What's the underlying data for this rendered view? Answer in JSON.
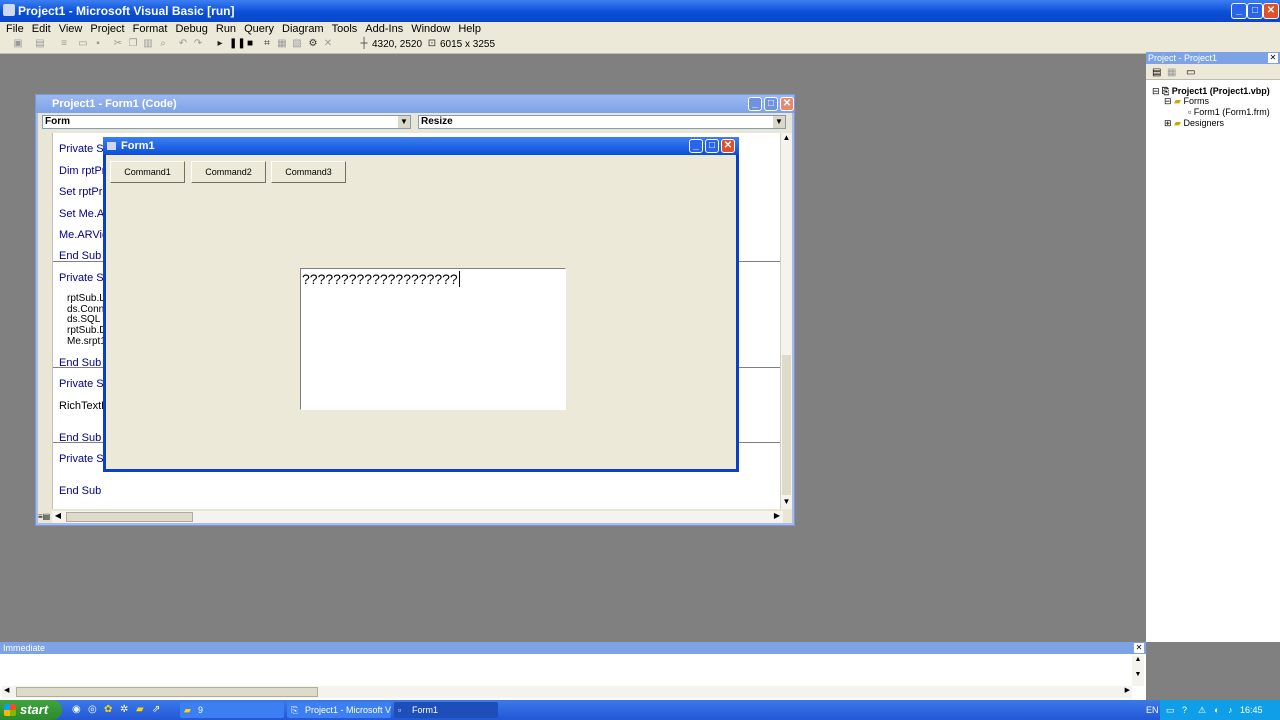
{
  "app": {
    "title": "Project1 - Microsoft Visual Basic [run]"
  },
  "menubar": [
    {
      "label": "File"
    },
    {
      "label": "Edit"
    },
    {
      "label": "View"
    },
    {
      "label": "Project"
    },
    {
      "label": "Format"
    },
    {
      "label": "Debug"
    },
    {
      "label": "Run"
    },
    {
      "label": "Query"
    },
    {
      "label": "Diagram"
    },
    {
      "label": "Tools"
    },
    {
      "label": "Add-Ins"
    },
    {
      "label": "Window"
    },
    {
      "label": "Help"
    }
  ],
  "toolbar": {
    "position": "4320, 2520",
    "size": "6015 x 3255"
  },
  "code_window": {
    "title": "Project1 - Form1 (Code)",
    "object_combo": "Form",
    "procedure_combo": "Resize",
    "lines": [
      "Private Sub",
      "Dim rptPrint",
      "Set rptPrint",
      "Set Me.AR",
      "Me.ARView",
      "End Sub",
      "Private Sub",
      "rptSub.Lo",
      "ds.Conne",
      "ds.SQL =",
      "rptSub.Da",
      "Me.srpt1.",
      "End Sub",
      "Private Sub",
      "RichTextBo",
      "End Sub",
      "Private Sub",
      "End Sub"
    ]
  },
  "form1": {
    "title": "Form1",
    "buttons": [
      "Command1",
      "Command2",
      "Command3"
    ],
    "rich_text": "????????????????????"
  },
  "project_explorer": {
    "title": "Project - Project1",
    "root": "Project1 (Project1.vbp)",
    "forms_folder": "Forms",
    "form_item": "Form1 (Form1.frm)",
    "designers_folder": "Designers"
  },
  "immediate": {
    "title": "Immediate"
  },
  "taskbar": {
    "start": "start",
    "tasks": [
      {
        "label": "9"
      },
      {
        "label": "Project1 - Microsoft V..."
      },
      {
        "label": "Form1"
      }
    ],
    "lang": "EN",
    "time": "16:45"
  }
}
